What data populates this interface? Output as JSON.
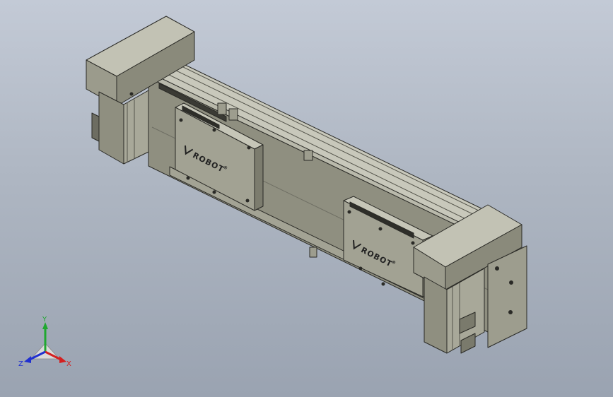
{
  "model": {
    "carriage_logo_text": "ROBOT",
    "registered_mark": "®"
  },
  "triad": {
    "x_label": "X",
    "y_label": "Y",
    "z_label": "Z"
  },
  "colors": {
    "background_top": "#c3cad6",
    "background_bottom": "#9aa3b1",
    "body_light": "#b4b4a6",
    "body_mid": "#9a9a8a",
    "body_dark": "#6d6d62",
    "edge": "#2a2a26",
    "axis_x": "#d42020",
    "axis_y": "#20a830",
    "axis_z": "#2030d0"
  }
}
